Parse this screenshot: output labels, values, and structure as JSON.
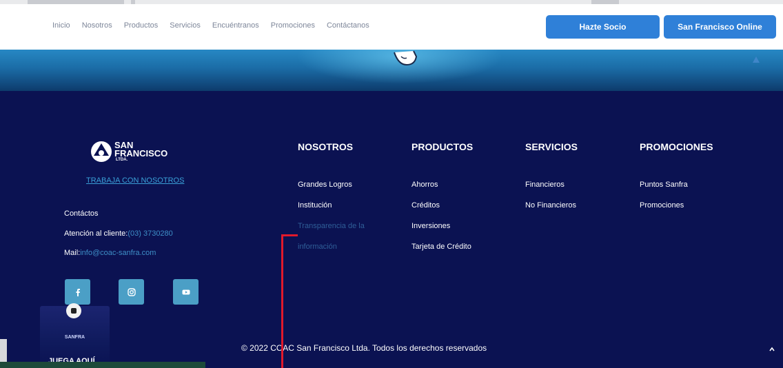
{
  "nav": {
    "links": [
      "Inicio",
      "Nosotros",
      "Productos",
      "Servicios",
      "Encuéntranos",
      "Promociones",
      "Contáctanos"
    ],
    "btn_socio": "Hazte Socio",
    "btn_online": "San Francisco Online"
  },
  "footer": {
    "logo": {
      "line1": "SAN",
      "line2": "FRANCISCO",
      "line3": "LTDA."
    },
    "trabaja": "TRABAJA CON NOSOTROS",
    "contactos_label": "Contáctos",
    "atencion_label": "Atención al cliente:",
    "atencion_value": "(03) 3730280",
    "mail_label": "Mail:",
    "mail_value": "info@coac-sanfra.com",
    "social": [
      "facebook-icon",
      "instagram-icon",
      "youtube-icon"
    ],
    "columns": [
      {
        "title": "NOSOTROS",
        "items": [
          "Grandes Logros",
          "Institución",
          "Transparencia de la",
          "información"
        ]
      },
      {
        "title": "PRODUCTOS",
        "items": [
          "Ahorros",
          "Créditos",
          "Inversiones",
          "Tarjeta de Crédito"
        ]
      },
      {
        "title": "SERVICIOS",
        "items": [
          "Financieros",
          "No Financieros"
        ]
      },
      {
        "title": "PROMOCIONES",
        "items": [
          "Puntos Sanfra",
          "Promociones"
        ]
      }
    ],
    "copyright": "© 2022 COAC San Francisco Ltda. Todos los derechos reservados"
  },
  "widget": {
    "logo_text": "SANFRA",
    "label": "JUEGA AQUÍ"
  },
  "colors": {
    "navy": "#0b1252",
    "accent_blue": "#2f80d8",
    "link_blue": "#3e8fc7",
    "social_bg": "#4b9fc6",
    "marker": "#e0192b"
  }
}
